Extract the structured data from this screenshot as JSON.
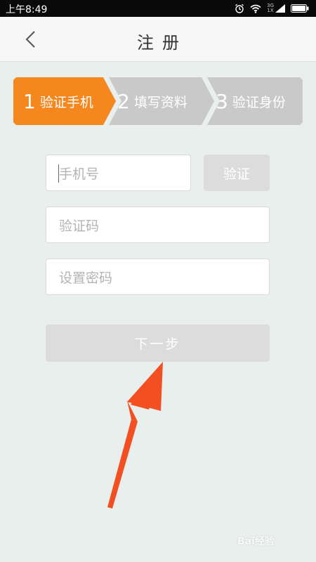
{
  "status_bar": {
    "time": "上午8:49",
    "network": "3G\n1X",
    "icons": [
      "alarm-icon",
      "wifi-icon",
      "signal-icon",
      "battery-icon"
    ]
  },
  "header": {
    "back_icon": "chevron-left-icon",
    "title": "注册"
  },
  "steps": [
    {
      "number": "1",
      "label": "验证手机",
      "active": true
    },
    {
      "number": "2",
      "label": "填写资料",
      "active": false
    },
    {
      "number": "3",
      "label": "验证身份",
      "active": false
    }
  ],
  "form": {
    "phone_placeholder": "手机号",
    "verify_button": "验证",
    "code_placeholder": "验证码",
    "password_placeholder": "设置密码",
    "next_button": "下一步"
  },
  "watermark": "Bai经验",
  "colors": {
    "accent": "#f5871f",
    "step_inactive": "#c9c9c9",
    "arrow": "#f25022",
    "background": "#e9efed"
  }
}
